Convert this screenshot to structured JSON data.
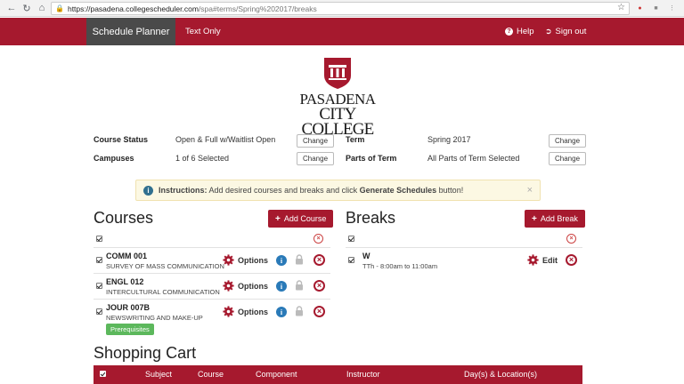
{
  "browser": {
    "url_host": "https://pasadena.collegescheduler.com",
    "url_path": "/spa#terms/Spring%202017/breaks"
  },
  "nav": {
    "active_tab": "Schedule Planner",
    "text_only": "Text Only",
    "help": "Help",
    "sign_out": "Sign out"
  },
  "logo": {
    "line1": "PASADENA",
    "line2": "CITY COLLEGE"
  },
  "filters": {
    "course_status_label": "Course Status",
    "course_status_value": "Open & Full w/Waitlist Open",
    "campuses_label": "Campuses",
    "campuses_value": "1 of 6 Selected",
    "term_label": "Term",
    "term_value": "Spring 2017",
    "parts_label": "Parts of Term",
    "parts_value": "All Parts of Term Selected",
    "change_label": "Change"
  },
  "instructions": {
    "prefix": "Instructions:",
    "text1": " Add desired courses and breaks and click ",
    "emph": "Generate Schedules",
    "text2": " button!"
  },
  "courses": {
    "heading": "Courses",
    "add_button": "Add Course",
    "options_label": "Options",
    "items": [
      {
        "code": "COMM 001",
        "title": "SURVEY OF MASS COMMUNICATION"
      },
      {
        "code": "ENGL 012",
        "title": "INTERCULTURAL COMMUNICATION"
      },
      {
        "code": "JOUR 007B",
        "title": "NEWSWRITING AND MAKE-UP"
      }
    ],
    "prerequisites": "Prerequisites"
  },
  "breaks": {
    "heading": "Breaks",
    "add_button": "Add Break",
    "edit_label": "Edit",
    "items": [
      {
        "name": "W",
        "time": "TTh - 8:00am to 11:00am"
      }
    ]
  },
  "cart": {
    "heading": "Shopping Cart",
    "columns": [
      "Subject",
      "Course",
      "Component",
      "Instructor",
      "Day(s) & Location(s)"
    ]
  },
  "colors": {
    "brand": "#a6192e",
    "info": "#2a7ab8",
    "success": "#5cb85c"
  }
}
